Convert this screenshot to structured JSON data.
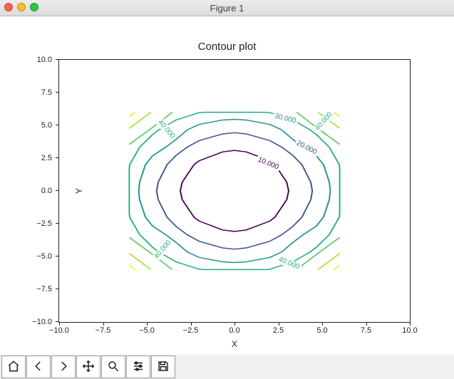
{
  "window": {
    "title": "Figure 1"
  },
  "chart_data": {
    "type": "contour",
    "title": "Contour plot",
    "xlabel": "X",
    "ylabel": "Y",
    "xlim": [
      -10.0,
      10.0
    ],
    "ylim": [
      -10.0,
      10.0
    ],
    "xticks": [
      -10.0,
      -7.5,
      -5.0,
      -2.5,
      0.0,
      2.5,
      5.0,
      7.5,
      10.0
    ],
    "yticks": [
      -10.0,
      -7.5,
      -5.0,
      -2.5,
      0.0,
      2.5,
      5.0,
      7.5,
      10.0
    ],
    "xtick_labels": [
      "−10.0",
      "−7.5",
      "−5.0",
      "−2.5",
      "0.0",
      "2.5",
      "5.0",
      "7.5",
      "10.0"
    ],
    "ytick_labels": [
      "−10.0",
      "−7.5",
      "−5.0",
      "−2.5",
      "0.0",
      "2.5",
      "5.0",
      "7.5",
      "10.0"
    ],
    "function": "Z = X^2 + Y^2",
    "levels": [
      10.0,
      20.0,
      30.0,
      40.0,
      50.0,
      60.0,
      70.0
    ],
    "level_labels": [
      "10.000",
      "20.000",
      "30.000",
      "40.000",
      "40.000",
      "40.000",
      "40.000"
    ],
    "colormap": "viridis",
    "level_colors": [
      "#440154",
      "#3b528b",
      "#21918c",
      "#27ad81",
      "#5ec962",
      "#addc30",
      "#fde725"
    ],
    "grid_x": [
      -6,
      -4.67,
      -3.33,
      -2,
      -0.67,
      0.67,
      2,
      3.33,
      4.67,
      6
    ],
    "grid_y": [
      -6,
      -4.67,
      -3.33,
      -2,
      -0.67,
      0.67,
      2,
      3.33,
      4.67,
      6
    ],
    "clabels": {
      "l10": "10.000",
      "l20": "20.000",
      "l30": "30.000",
      "l40_tl": "40.000",
      "l40_tr": "40.000",
      "l40_bl": "40.000",
      "l40_br": "40.000"
    }
  },
  "toolbar": {
    "home": "Home",
    "back": "Back",
    "forward": "Forward",
    "pan": "Pan",
    "zoom": "Zoom",
    "configure": "Configure subplots",
    "save": "Save"
  }
}
